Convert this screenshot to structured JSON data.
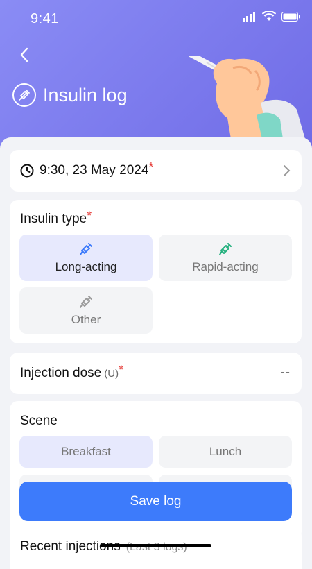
{
  "status": {
    "time": "9:41"
  },
  "header": {
    "title": "Insulin log"
  },
  "log_time": {
    "value": "9:30, 23 May 2024",
    "required_mark": "*"
  },
  "insulin_type": {
    "label": "Insulin type",
    "required_mark": "*",
    "options": [
      {
        "label": "Long-acting",
        "selected": true,
        "icon_color": "#3d7bfb"
      },
      {
        "label": "Rapid-acting",
        "selected": false,
        "icon_color": "#22b07d"
      },
      {
        "label": "Other",
        "selected": false,
        "icon_color": "#9a9a9a"
      }
    ]
  },
  "dose": {
    "label": "Injection dose",
    "unit": "(U)",
    "required_mark": "*",
    "value": "--"
  },
  "scene": {
    "label": "Scene",
    "options": [
      {
        "label": "Breakfast",
        "selected": true
      },
      {
        "label": "Lunch",
        "selected": false
      }
    ]
  },
  "actions": {
    "save_label": "Save log"
  },
  "recent": {
    "title": "Recent injections",
    "subtitle": "(Last 3 logs)"
  },
  "colors": {
    "accent": "#3d7bfb",
    "header_start": "#8a8cf5",
    "header_end": "#6f6be6",
    "required": "#e53935"
  }
}
